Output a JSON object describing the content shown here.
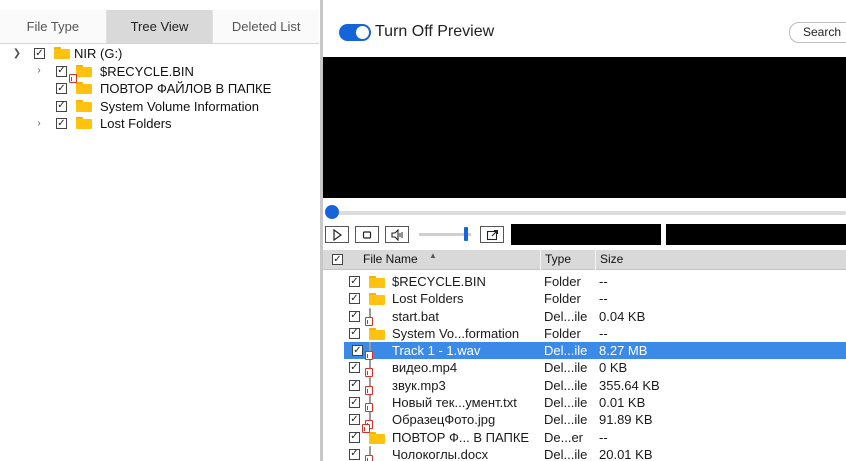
{
  "tabs": [
    {
      "label": "File Type",
      "active": false
    },
    {
      "label": "Tree View",
      "active": true
    },
    {
      "label": "Deleted List",
      "active": false
    }
  ],
  "tree": [
    {
      "label": "NIR (G:)",
      "expanded": true,
      "checked": true,
      "icon": "folder-icon"
    },
    {
      "label": "$RECYCLE.BIN",
      "expandable": true,
      "checked": true,
      "icon": "folder-icon"
    },
    {
      "label": "ПОВТОР ФАЙЛОВ В ПАПКЕ",
      "expandable": false,
      "checked": true,
      "icon": "deleted-folder-icon"
    },
    {
      "label": "System Volume Information",
      "expandable": false,
      "checked": true,
      "icon": "folder-icon"
    },
    {
      "label": "Lost Folders",
      "expandable": true,
      "checked": true,
      "icon": "folder-icon"
    }
  ],
  "preview": {
    "toggle_label": "Turn Off Preview",
    "toggle_on": true,
    "search_label": "Search",
    "seek_position": 0.0,
    "volume_level": 0.95
  },
  "table": {
    "columns": [
      "File Name",
      "Type",
      "Size"
    ],
    "sorted_by": "File Name",
    "rows": [
      {
        "name": "$RECYCLE.BIN",
        "type": "Folder",
        "size": "--",
        "icon": "folder-icon",
        "checked": true,
        "selected": false
      },
      {
        "name": "Lost Folders",
        "type": "Folder",
        "size": "--",
        "icon": "folder-icon",
        "checked": true,
        "selected": false
      },
      {
        "name": "start.bat",
        "type": "Del...ile",
        "size": "0.04 KB",
        "icon": "deleted-file-icon",
        "checked": true,
        "selected": false
      },
      {
        "name": "System Vo...formation",
        "type": "Folder",
        "size": "--",
        "icon": "folder-icon",
        "checked": true,
        "selected": false
      },
      {
        "name": "Track 1 - 1.wav",
        "type": "Del...ile",
        "size": "8.27 MB",
        "icon": "deleted-file-icon",
        "checked": true,
        "selected": true
      },
      {
        "name": "видео.mp4",
        "type": "Del...ile",
        "size": "0 KB",
        "icon": "deleted-file-icon",
        "checked": true,
        "selected": false
      },
      {
        "name": "звук.mp3",
        "type": "Del...ile",
        "size": "355.64 KB",
        "icon": "deleted-file-icon",
        "checked": true,
        "selected": false
      },
      {
        "name": "Новый тек...умент.txt",
        "type": "Del...ile",
        "size": "0.01 KB",
        "icon": "deleted-file-icon",
        "checked": true,
        "selected": false
      },
      {
        "name": "ОбразецФото.jpg",
        "type": "Del...ile",
        "size": "91.89 KB",
        "icon": "deleted-file-icon",
        "checked": true,
        "selected": false
      },
      {
        "name": "ПОВТОР Ф... В ПАПКЕ",
        "type": "De...er",
        "size": "--",
        "icon": "deleted-folder-icon",
        "checked": true,
        "selected": false
      },
      {
        "name": "Чолокоглы.docx",
        "type": "Del...ile",
        "size": "20.01 KB",
        "icon": "deleted-file-icon",
        "checked": true,
        "selected": false
      }
    ]
  },
  "colors": {
    "accent": "#1565d8",
    "selection": "#3b8ae8",
    "folder": "#ffc20e",
    "deleted_mark": "#d9302c",
    "header_bg": "#d9d9d9"
  }
}
